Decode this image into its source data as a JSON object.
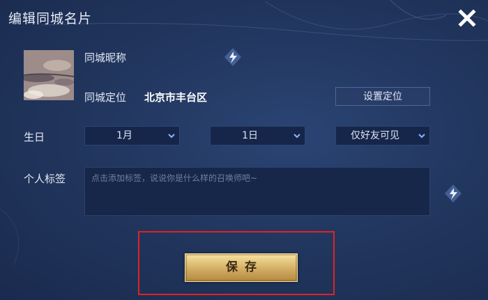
{
  "dialog": {
    "title": "编辑同城名片",
    "close_icon": "close-icon"
  },
  "profile": {
    "nickname_label": "同城昵称",
    "location_label": "同城定位",
    "location_value": "北京市丰台区",
    "set_location_label": "设置定位"
  },
  "birthday": {
    "label": "生日",
    "month": "1月",
    "day": "1日",
    "visibility": "仅好友可见"
  },
  "tags": {
    "label": "个人标签",
    "placeholder": "点击添加标签，说说你是什么样的召唤师吧~"
  },
  "actions": {
    "save_label": "保存"
  },
  "colors": {
    "background": "#22375f",
    "highlight_border": "#e02323",
    "save_button": "#d9b56b"
  }
}
